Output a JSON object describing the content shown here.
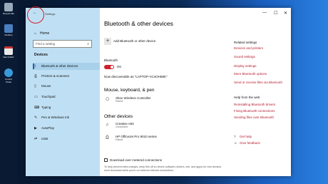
{
  "desktop": {
    "icons": [
      {
        "label": "Recycle Bin"
      },
      {
        "label": "Desktop"
      },
      {
        "label": "New Folder"
      },
      {
        "label": "Control Panel"
      }
    ]
  },
  "window": {
    "title": "Settings",
    "controls": {
      "minimize": "—",
      "maximize": "☐",
      "close": "✕"
    }
  },
  "sidebar": {
    "home_label": "Home",
    "search_placeholder": "Find a setting",
    "section_title": "Devices",
    "items": [
      {
        "label": "Bluetooth & other devices",
        "icon": "bluetooth-icon",
        "active": true
      },
      {
        "label": "Printers & scanners",
        "icon": "printer-icon"
      },
      {
        "label": "Mouse",
        "icon": "mouse-icon"
      },
      {
        "label": "Touchpad",
        "icon": "touchpad-icon"
      },
      {
        "label": "Typing",
        "icon": "keyboard-icon"
      },
      {
        "label": "Pen & Windows Ink",
        "icon": "pen-icon"
      },
      {
        "label": "AutoPlay",
        "icon": "autoplay-icon"
      },
      {
        "label": "USB",
        "icon": "usb-icon"
      }
    ]
  },
  "main": {
    "title": "Bluetooth & other devices",
    "add_label": "Add Bluetooth or other device",
    "bluetooth_label": "Bluetooth",
    "bluetooth_state": "On",
    "discoverable_text": "Now discoverable as \"LAPTOP-VC4OH58K\"",
    "mkp_heading": "Mouse, keyboard, & pen",
    "mkp_devices": [
      {
        "name": "Xbox Wireless Controller",
        "status": "Paired"
      }
    ],
    "other_heading": "Other devices",
    "other_devices": [
      {
        "name": "Creative A50",
        "status": "Connected"
      },
      {
        "name": "HP OfficeJet Pro 9010 series",
        "status": "Paired"
      }
    ],
    "metered_label": "Download over metered connections",
    "metered_note": "To help prevent extra charges, keep this off so device software (drivers, info, and apps) for new devices won't download while you're on metered Internet connections."
  },
  "related": {
    "heading": "Related settings",
    "links": [
      "Devices and printers",
      "Sound settings",
      "Display settings",
      "More Bluetooth options",
      "Send or receive files via Bluetooth"
    ],
    "help_heading": "Help from the web",
    "help_links": [
      "Reinstalling Bluetooth drivers",
      "Fixing Bluetooth connections",
      "Sending files over Bluetooth"
    ],
    "get_help": "Get help",
    "feedback": "Give feedback"
  }
}
